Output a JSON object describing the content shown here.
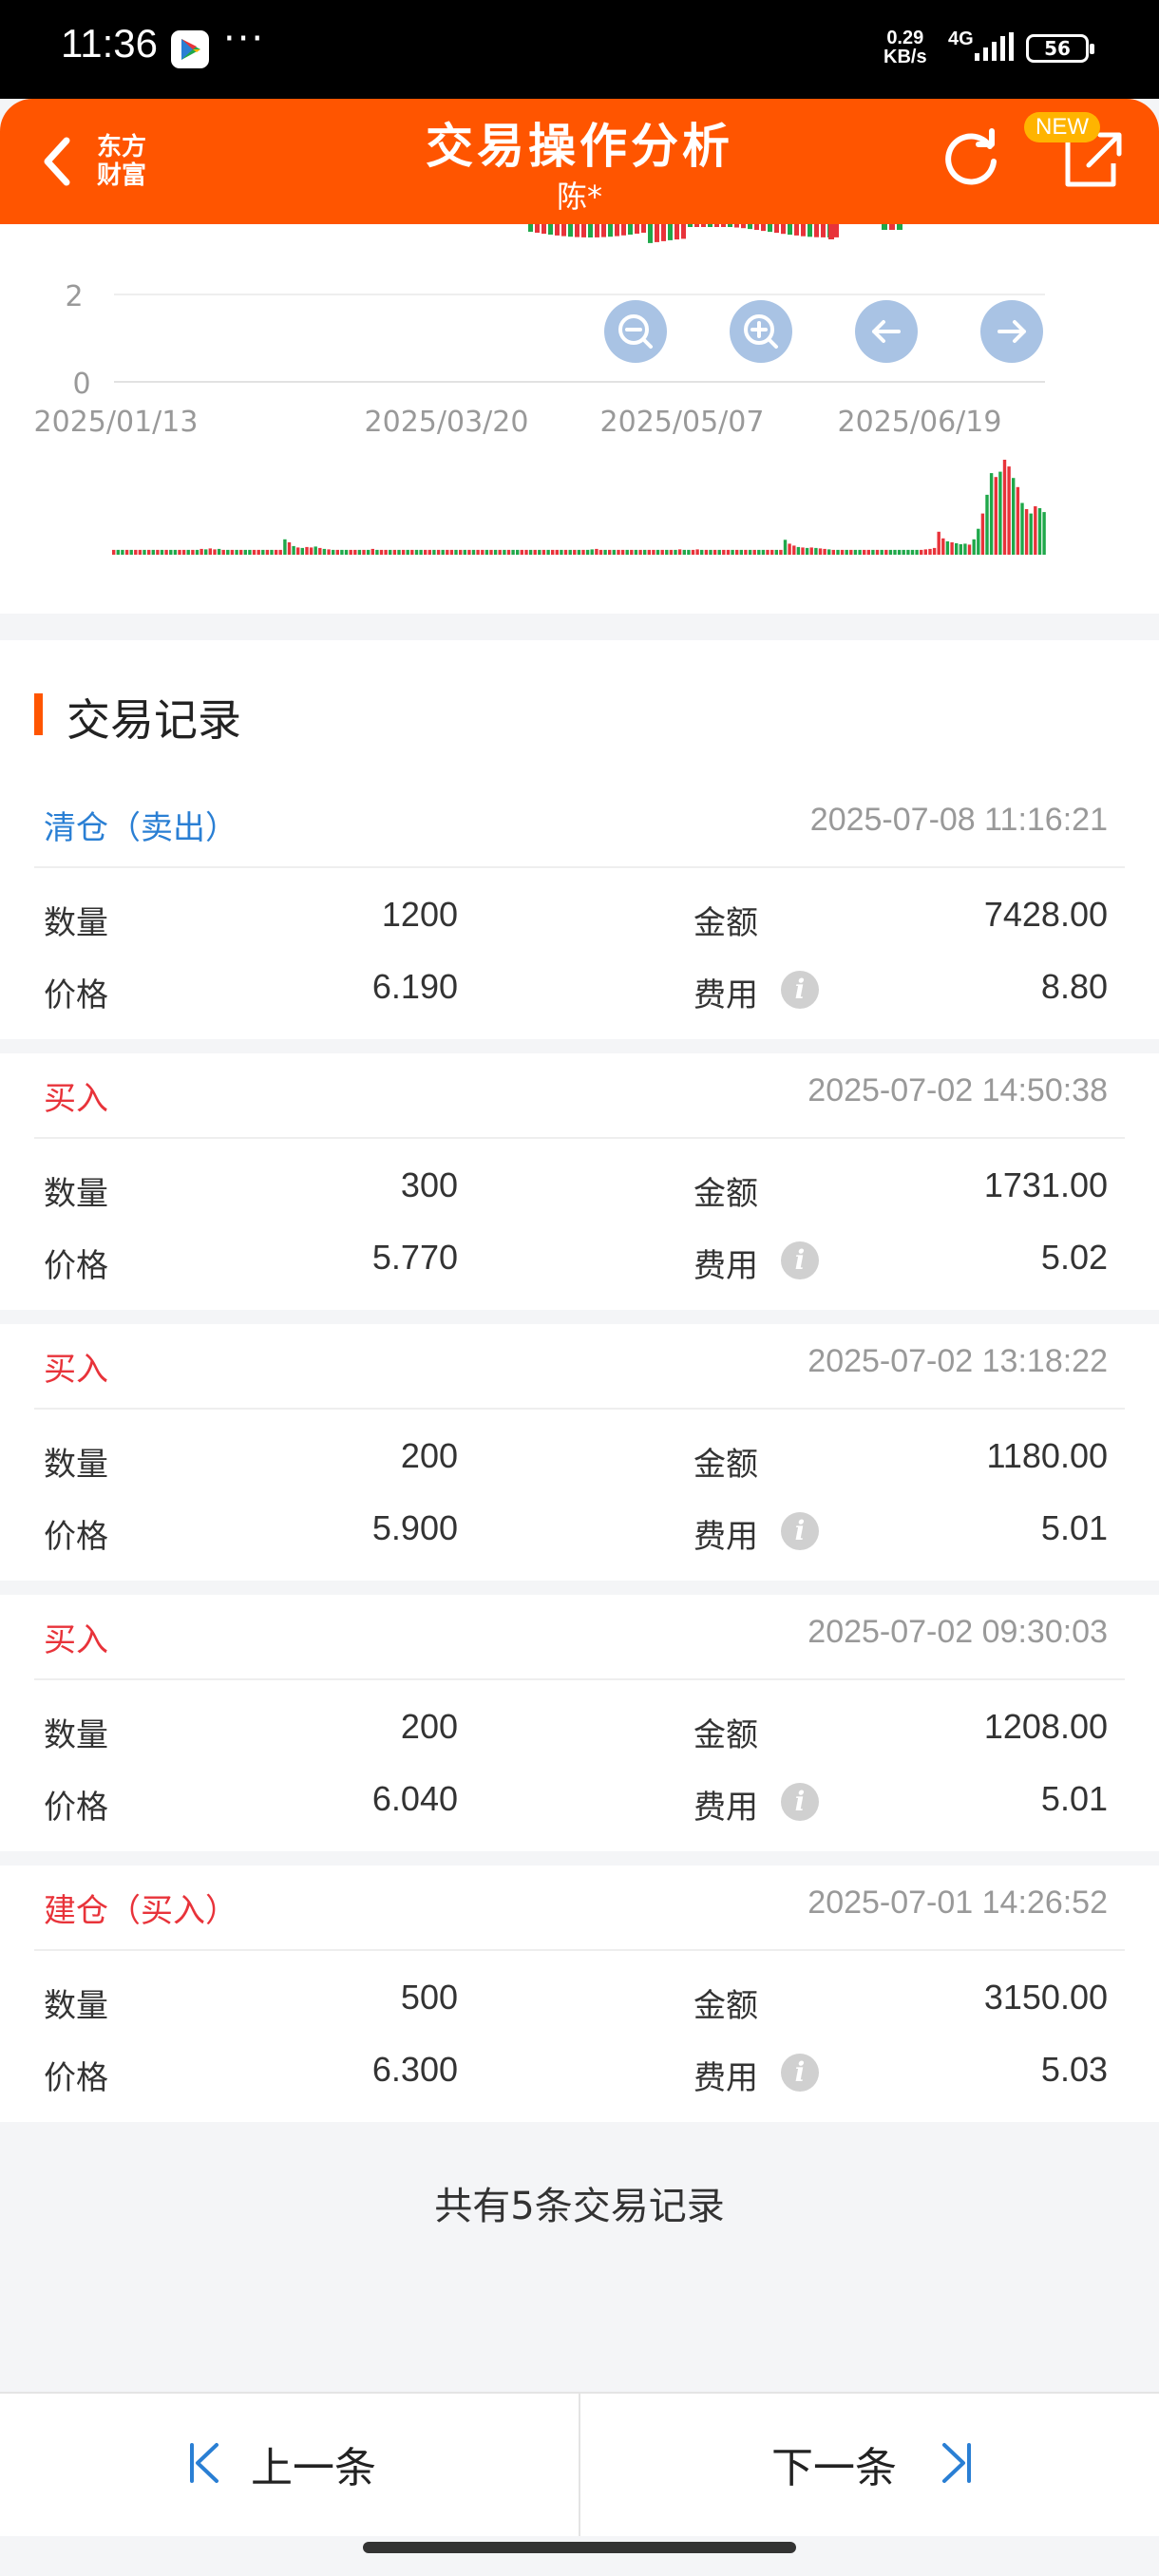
{
  "status": {
    "time": "11:36",
    "speed_top": "0.29",
    "speed_bottom": "KB/s",
    "network": "4G",
    "battery": "56"
  },
  "header": {
    "brand": "东方财富",
    "title": "交易操作分析",
    "subtitle": "陈*",
    "new_badge": "NEW"
  },
  "chart_data": {
    "type": "candlestick",
    "y_ticks": [
      "2",
      "0"
    ],
    "x_ticks": [
      "2025/01/13",
      "2025/03/20",
      "2025/05/07",
      "2025/06/19"
    ],
    "colors": {
      "up": "#e8333a",
      "down": "#1fa84a",
      "zoom_button": "#a9c3e4"
    },
    "volume": [
      1,
      1,
      1,
      1,
      1,
      1,
      1,
      1,
      1,
      1,
      1,
      1,
      1,
      1,
      1,
      1,
      1,
      1,
      1,
      1,
      1.2,
      1.1,
      1.3,
      1.1,
      1.2,
      1,
      1,
      1,
      1,
      1,
      1,
      1,
      1,
      1,
      1,
      1,
      1,
      1,
      1,
      3.2,
      2.6,
      1.8,
      1.5,
      1.4,
      1.6,
      1.5,
      1.7,
      1.4,
      1.2,
      1.1,
      1,
      1,
      1,
      1,
      1,
      1,
      1,
      1,
      1,
      1.2,
      1,
      1,
      1,
      1,
      1,
      1,
      1,
      1,
      1,
      1,
      1,
      1,
      1,
      1,
      1,
      1,
      1,
      1,
      1,
      1,
      1,
      1,
      1,
      1,
      1,
      1,
      1,
      1,
      1,
      1,
      1,
      1,
      1,
      1,
      1,
      1,
      1,
      1,
      1,
      1,
      1,
      1,
      1,
      1,
      1,
      1,
      1,
      1,
      1,
      1.1,
      1.2,
      1,
      1,
      1,
      1,
      1,
      1,
      1,
      1,
      1,
      1,
      1,
      1,
      1,
      1,
      1,
      1,
      1,
      1,
      1.1,
      1,
      1,
      1,
      1.1,
      1,
      1,
      1,
      1,
      1,
      1,
      1,
      1,
      1,
      1,
      1,
      1,
      1,
      1,
      1,
      1,
      1,
      1,
      1,
      3.1,
      2.3,
      1.9,
      1.6,
      1.5,
      1.4,
      1.5,
      1.4,
      1.3,
      1.2,
      1.1,
      1,
      1,
      1,
      1,
      1,
      1,
      1,
      1,
      1,
      1,
      1,
      1,
      1,
      1,
      1,
      1,
      1,
      1,
      1,
      1,
      1,
      1.1,
      1.2,
      1.4,
      4.8,
      3.4,
      2.8,
      2.6,
      2.4,
      2.2,
      2.3,
      2.1,
      3.2,
      5.4,
      8.6,
      12.5,
      17,
      16.2,
      17.3,
      19.8,
      18.4,
      16,
      14.1,
      10.8,
      9.5,
      8.6,
      10.1,
      9.7,
      8.9
    ],
    "volume_colors": "rggrgrrgrgrgrggrrgrgrgrrgrgrgrggrrgrgrrgrgrgrrgrgrgrggrrgrgrgrrgrgrgrggrrgrgrrgrgrgrrgrgrgrggrrgrgrgrrgrgrgrggrrgrgrrgrgrgrrgrgrgrggrrgrgrgrrgrgrgrggrrgrgrrgrgrgrrgrgrgrggrrgrgrgggggggrrrrrrgrgggrgg"
  },
  "records_section": {
    "title": "交易记录"
  },
  "records": [
    {
      "type": "清仓（卖出）",
      "type_color": "#2a7fd4",
      "time": "2025-07-08 11:16:21",
      "qty_label": "数量",
      "qty": "1200",
      "amount_label": "金额",
      "amount": "7428.00",
      "price_label": "价格",
      "price": "6.190",
      "fee_label": "费用",
      "fee": "8.80"
    },
    {
      "type": "买入",
      "type_color": "#e8333a",
      "time": "2025-07-02 14:50:38",
      "qty_label": "数量",
      "qty": "300",
      "amount_label": "金额",
      "amount": "1731.00",
      "price_label": "价格",
      "price": "5.770",
      "fee_label": "费用",
      "fee": "5.02"
    },
    {
      "type": "买入",
      "type_color": "#e8333a",
      "time": "2025-07-02 13:18:22",
      "qty_label": "数量",
      "qty": "200",
      "amount_label": "金额",
      "amount": "1180.00",
      "price_label": "价格",
      "price": "5.900",
      "fee_label": "费用",
      "fee": "5.01"
    },
    {
      "type": "买入",
      "type_color": "#e8333a",
      "time": "2025-07-02 09:30:03",
      "qty_label": "数量",
      "qty": "200",
      "amount_label": "金额",
      "amount": "1208.00",
      "price_label": "价格",
      "price": "6.040",
      "fee_label": "费用",
      "fee": "5.01"
    },
    {
      "type": "建仓（买入）",
      "type_color": "#e8333a",
      "time": "2025-07-01 14:26:52",
      "qty_label": "数量",
      "qty": "500",
      "amount_label": "金额",
      "amount": "3150.00",
      "price_label": "价格",
      "price": "6.300",
      "fee_label": "费用",
      "fee": "5.03"
    }
  ],
  "footer": {
    "count_text": "共有5条交易记录"
  },
  "nav": {
    "prev": "上一条",
    "next": "下一条"
  }
}
